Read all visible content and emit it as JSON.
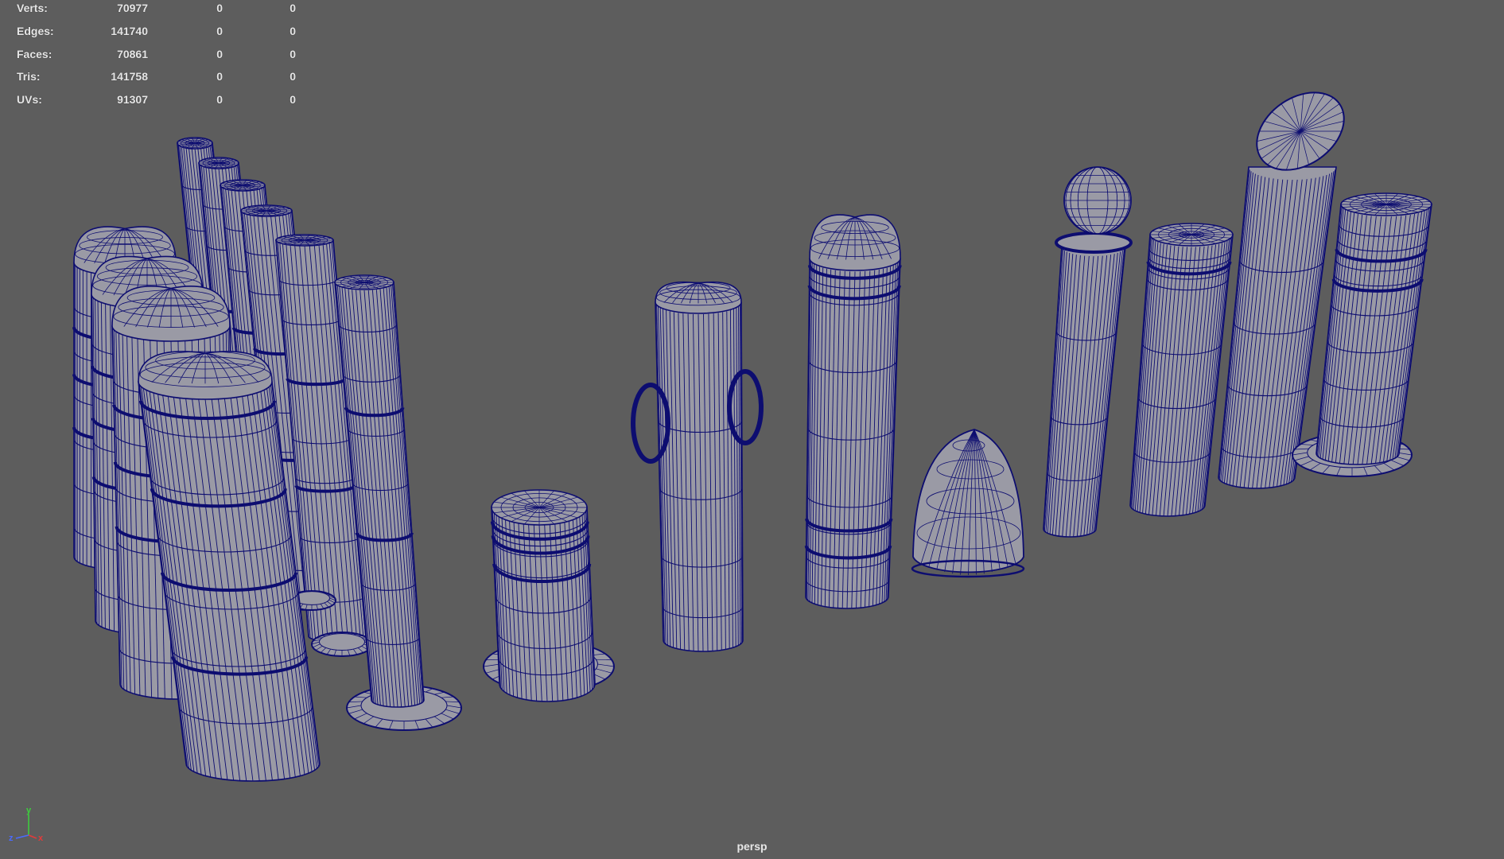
{
  "viewport": {
    "background_color": "#5d5d5d",
    "wire_color": "#0d0d70",
    "shade_color": "#9a9aa5",
    "camera_label": "persp"
  },
  "hud": {
    "rows": [
      {
        "label": "Verts:",
        "v1": "70977",
        "v2": "0",
        "v3": "0"
      },
      {
        "label": "Edges:",
        "v1": "141740",
        "v2": "0",
        "v3": "0"
      },
      {
        "label": "Faces:",
        "v1": "70861",
        "v2": "0",
        "v3": "0"
      },
      {
        "label": "Tris:",
        "v1": "141758",
        "v2": "0",
        "v3": "0"
      },
      {
        "label": "UVs:",
        "v1": "91307",
        "v2": "0",
        "v3": "0"
      }
    ]
  },
  "axis": {
    "y_label": "y",
    "z_label": "z",
    "x_label": "x",
    "y_color": "#3cd23c",
    "z_color": "#4a6bff",
    "x_color": "#e33a3a"
  }
}
